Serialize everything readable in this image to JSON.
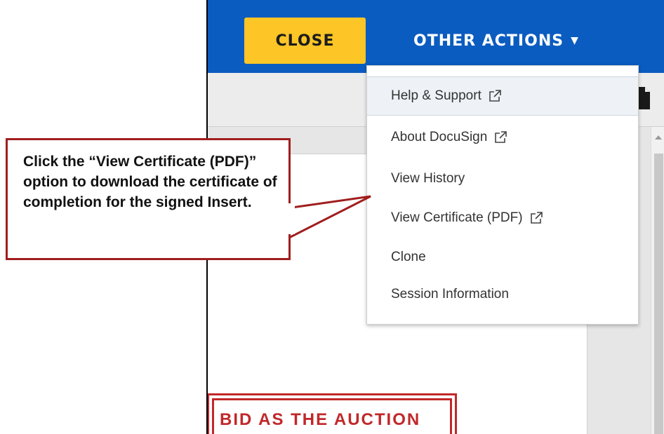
{
  "header": {
    "close_label": "CLOSE",
    "other_actions_label": "OTHER ACTIONS",
    "caret": "▼"
  },
  "menu": {
    "items": [
      {
        "label": "Help & Support",
        "external": true
      },
      {
        "label": "About DocuSign",
        "external": true
      },
      {
        "label": "View History",
        "external": false
      },
      {
        "label": "View Certificate (PDF)",
        "external": true
      },
      {
        "label": "Clone",
        "external": false
      },
      {
        "label": "Session Information",
        "external": false
      }
    ]
  },
  "document": {
    "stamp_text": "BID AS THE AUCTION"
  },
  "callout": {
    "text": "Click the “View Certificate (PDF)” option to download the certificate of completion for the signed Insert."
  },
  "colors": {
    "topbar": "#0b5cc0",
    "close_button": "#fec526",
    "callout_border": "#a01e1e",
    "stamp": "#c0282a"
  },
  "icons": {
    "external_link": "external-link-icon",
    "document": "document-icon",
    "caret": "caret-down-icon"
  }
}
